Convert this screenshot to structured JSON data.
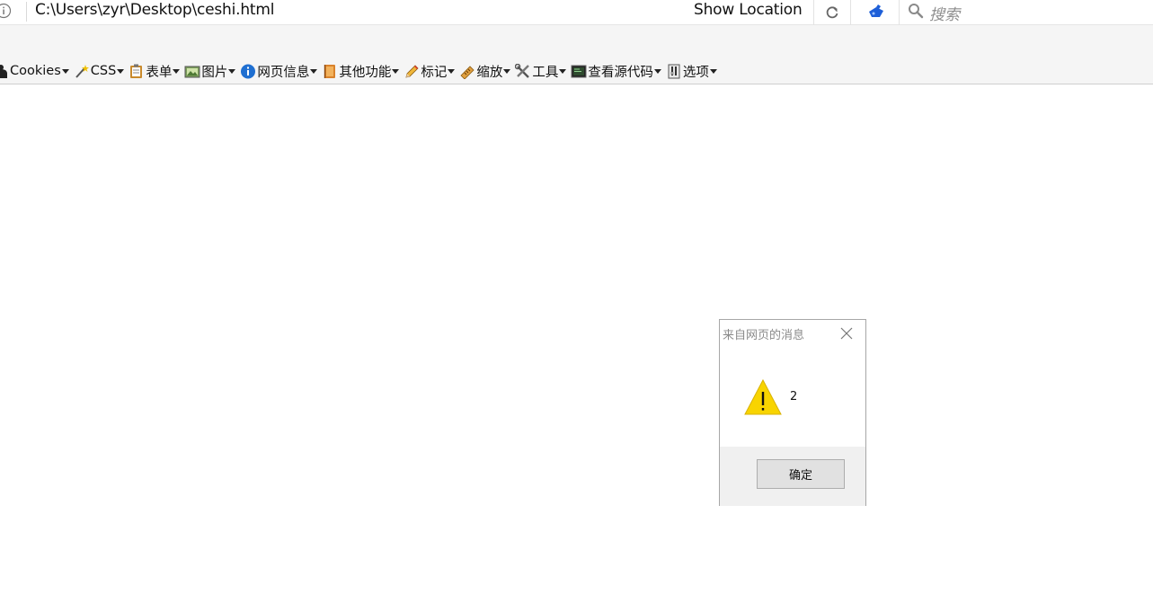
{
  "address_bar": {
    "url": "C:\\Users\\zyr\\Desktop\\ceshi.html",
    "show_location_label": "Show Location",
    "search_placeholder": "搜索"
  },
  "toolbar": {
    "items": [
      {
        "label": "Cookies",
        "icon": "cookie-icon"
      },
      {
        "label": "CSS",
        "icon": "wand-icon"
      },
      {
        "label": "表单",
        "icon": "clipboard-icon"
      },
      {
        "label": "图片",
        "icon": "image-icon"
      },
      {
        "label": "网页信息",
        "icon": "info-icon"
      },
      {
        "label": "其他功能",
        "icon": "book-icon"
      },
      {
        "label": "标记",
        "icon": "pencil-icon"
      },
      {
        "label": "缩放",
        "icon": "ruler-icon"
      },
      {
        "label": "工具",
        "icon": "tools-icon"
      },
      {
        "label": "查看源代码",
        "icon": "terminal-icon"
      },
      {
        "label": "选项",
        "icon": "switch-icon"
      }
    ]
  },
  "dialog": {
    "title": "来自网页的消息",
    "message": "2",
    "ok_label": "确定",
    "warning_color": "#f8d400"
  }
}
